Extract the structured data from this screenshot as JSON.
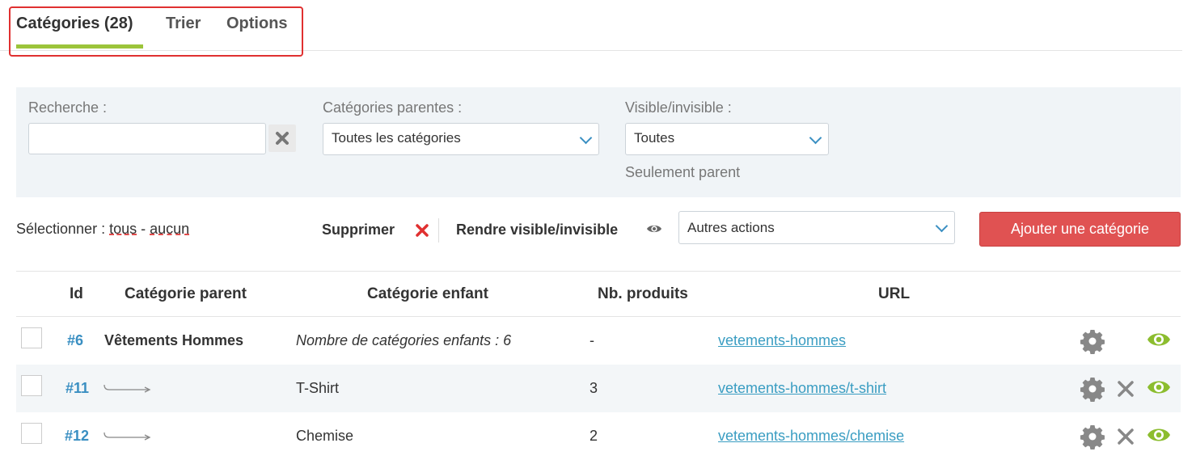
{
  "tabs": [
    {
      "label": "Catégories (28)"
    },
    {
      "label": "Trier"
    },
    {
      "label": "Options"
    }
  ],
  "filters": {
    "search_label": "Recherche :",
    "search_value": "",
    "parent_label": "Catégories parentes :",
    "parent_value": "Toutes les catégories",
    "visible_label": "Visible/invisible :",
    "visible_value": "Toutes",
    "only_parent": "Seulement parent"
  },
  "actions": {
    "select_prefix": "Sélectionner : ",
    "select_all": "tous",
    "select_sep": " - ",
    "select_none": "aucun",
    "delete": "Supprimer",
    "toggle_visible": "Rendre visible/invisible",
    "other_actions": "Autres actions",
    "add_category": "Ajouter une catégorie"
  },
  "table": {
    "headers": {
      "id": "Id",
      "parent": "Catégorie parent",
      "child": "Catégorie enfant",
      "count": "Nb. produits",
      "url": "URL"
    },
    "rows": [
      {
        "id": "#6",
        "parent": "Vêtements Hommes",
        "child": "Nombre de catégories enfants : 6",
        "count": "-",
        "url": "vetements-hommes"
      },
      {
        "id": "#11",
        "parent": "",
        "child": "T-Shirt",
        "count": "3",
        "url": "vetements-hommes/t-shirt"
      },
      {
        "id": "#12",
        "parent": "",
        "child": "Chemise",
        "count": "2",
        "url": "vetements-hommes/chemise"
      }
    ]
  },
  "colors": {
    "accent_green": "#9cc43a",
    "link_blue": "#3a8fc2",
    "danger_red": "#e05252",
    "highlight_red": "#e03030"
  }
}
